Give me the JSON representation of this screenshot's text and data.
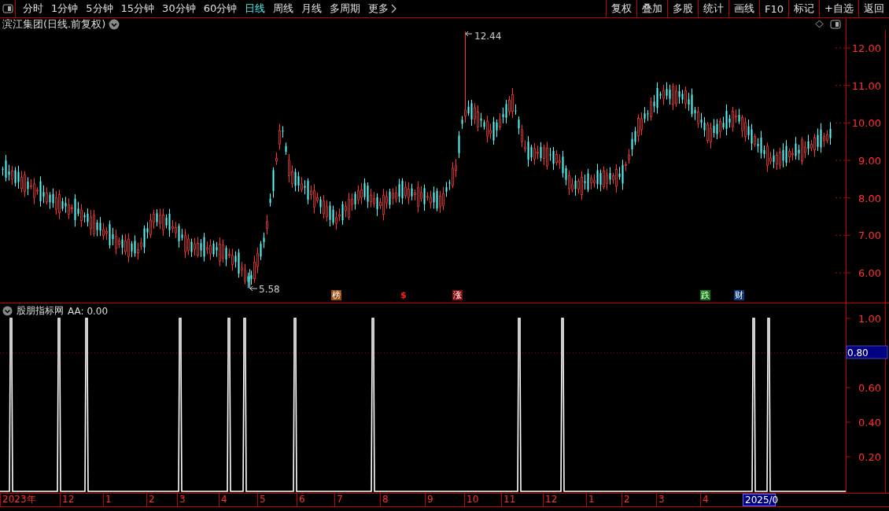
{
  "toolbar": {
    "tabs": [
      {
        "label": "分时",
        "selected": false
      },
      {
        "label": "1分钟",
        "selected": false
      },
      {
        "label": "5分钟",
        "selected": false
      },
      {
        "label": "15分钟",
        "selected": false
      },
      {
        "label": "30分钟",
        "selected": false
      },
      {
        "label": "60分钟",
        "selected": false
      },
      {
        "label": "日线",
        "selected": true
      },
      {
        "label": "周线",
        "selected": false
      },
      {
        "label": "月线",
        "selected": false
      },
      {
        "label": "多周期",
        "selected": false
      },
      {
        "label": "更多",
        "selected": false
      }
    ],
    "buttons": [
      "复权",
      "叠加",
      "多股",
      "统计",
      "画线",
      "F10",
      "标记",
      "+自选",
      "返回"
    ]
  },
  "chart": {
    "title": "滨江集团(日线.前复权)",
    "price_axis": [
      "12.00",
      "11.00",
      "10.00",
      "9.00",
      "8.00",
      "7.00",
      "6.00"
    ],
    "high_label": "12.44",
    "low_label": "5.58",
    "markers": [
      {
        "label": "榜",
        "kind": "badge",
        "color": "#9a4a0c"
      },
      {
        "label": "$",
        "kind": "glyph",
        "color": "#ff2020"
      },
      {
        "label": "涨",
        "kind": "badge",
        "color": "#8c0a0a"
      },
      {
        "label": "跌",
        "kind": "badge",
        "color": "#0c7a0c"
      },
      {
        "label": "财",
        "kind": "badge",
        "color": "#0c3a7a"
      }
    ]
  },
  "indicator": {
    "title": "股朋指标网",
    "reading": "AA: 0.00",
    "axis": [
      "1.00",
      "0.60",
      "0.40",
      "0.20"
    ],
    "current_value": "0.80"
  },
  "date_axis": [
    {
      "label": "2023年",
      "selected": false
    },
    {
      "label": "12",
      "selected": false
    },
    {
      "label": "1",
      "selected": false
    },
    {
      "label": "2",
      "selected": false
    },
    {
      "label": "3",
      "selected": false
    },
    {
      "label": "4",
      "selected": false
    },
    {
      "label": "5",
      "selected": false
    },
    {
      "label": "6",
      "selected": false
    },
    {
      "label": "7",
      "selected": false
    },
    {
      "label": "8",
      "selected": false
    },
    {
      "label": "9",
      "selected": false
    },
    {
      "label": "10",
      "selected": false
    },
    {
      "label": "11",
      "selected": false
    },
    {
      "label": "12",
      "selected": false
    },
    {
      "label": "1",
      "selected": false
    },
    {
      "label": "2",
      "selected": false
    },
    {
      "label": "3",
      "selected": false
    },
    {
      "label": "4",
      "selected": false
    },
    {
      "label": "2025/0",
      "selected": true
    }
  ]
}
